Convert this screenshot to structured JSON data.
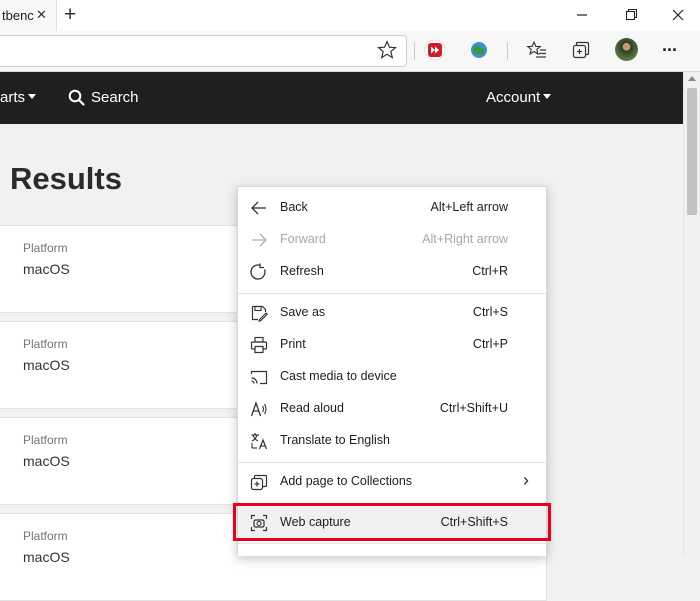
{
  "browser": {
    "tab_title": "tbenc",
    "tab_close": "✕",
    "new_tab": "+",
    "toolbar": {
      "more": "···"
    }
  },
  "page": {
    "nav": {
      "charts": "arts",
      "search": "Search",
      "account": "Account"
    },
    "heading": "Results",
    "cards": [
      {
        "label": "Platform",
        "value": "macOS"
      },
      {
        "label": "Platform",
        "value": "macOS"
      },
      {
        "label": "Platform",
        "value": "macOS"
      },
      {
        "label": "Platform",
        "value": "macOS"
      }
    ]
  },
  "context_menu": {
    "items": [
      {
        "label": "Back",
        "shortcut": "Alt+Left arrow",
        "icon": "back-arrow-icon",
        "disabled": false
      },
      {
        "label": "Forward",
        "shortcut": "Alt+Right arrow",
        "icon": "forward-arrow-icon",
        "disabled": true
      },
      {
        "label": "Refresh",
        "shortcut": "Ctrl+R",
        "icon": "refresh-icon",
        "disabled": false
      },
      {
        "label": "Save as",
        "shortcut": "Ctrl+S",
        "icon": "save-as-icon",
        "disabled": false
      },
      {
        "label": "Print",
        "shortcut": "Ctrl+P",
        "icon": "printer-icon",
        "disabled": false
      },
      {
        "label": "Cast media to device",
        "shortcut": "",
        "icon": "cast-icon",
        "disabled": false
      },
      {
        "label": "Read aloud",
        "shortcut": "Ctrl+Shift+U",
        "icon": "read-aloud-icon",
        "disabled": false
      },
      {
        "label": "Translate to English",
        "shortcut": "",
        "icon": "translate-icon",
        "disabled": false
      },
      {
        "label": "Add page to Collections",
        "shortcut": "",
        "icon": "collections-icon",
        "disabled": false,
        "submenu": "›"
      },
      {
        "label": "Web capture",
        "shortcut": "Ctrl+Shift+S",
        "icon": "web-capture-icon",
        "disabled": false
      }
    ],
    "highlight_color": "#e8001c"
  }
}
